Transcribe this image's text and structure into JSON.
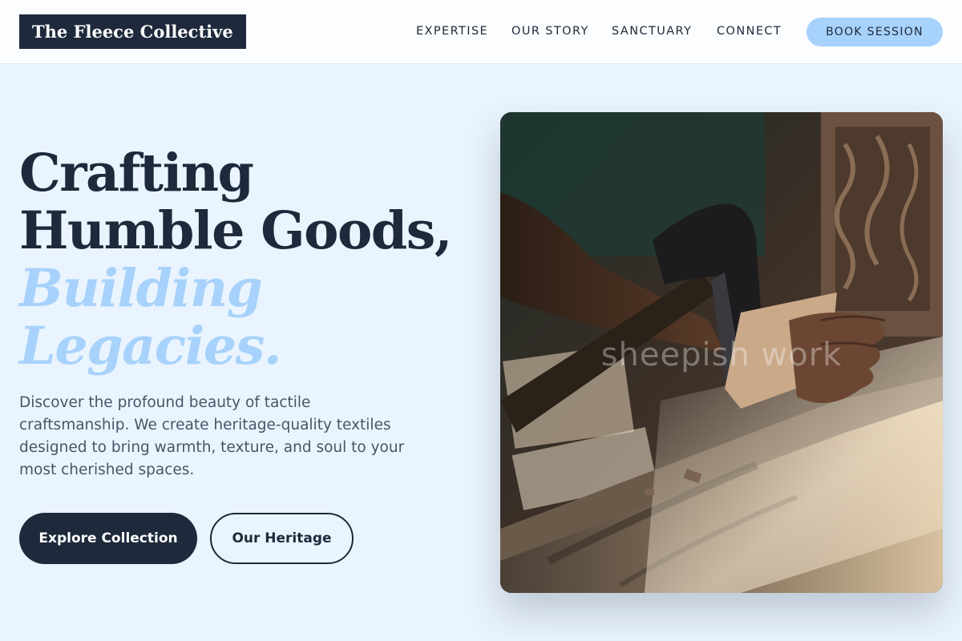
{
  "header": {
    "logo_text": "The Fleece Collective",
    "nav": [
      {
        "label": "EXPERTISE"
      },
      {
        "label": "OUR STORY"
      },
      {
        "label": "SANCTUARY"
      },
      {
        "label": "CONNECT"
      }
    ],
    "cta_label": "BOOK SESSION"
  },
  "hero": {
    "headline_line1": "Crafting",
    "headline_line2": "Humble Goods,",
    "headline_accent_line1": "Building",
    "headline_accent_line2": "Legacies.",
    "lead": "Discover the profound beauty of tactile craftsmanship. We create heritage-quality textiles designed to bring warmth, texture, and soul to your most cherished spaces.",
    "primary_button": "Explore Collection",
    "secondary_button": "Our Heritage",
    "image_watermark": "sheepish work"
  },
  "colors": {
    "navy": "#1e293b",
    "accent_blue": "#a7d2fb",
    "page_background": "#eaf4fe"
  }
}
